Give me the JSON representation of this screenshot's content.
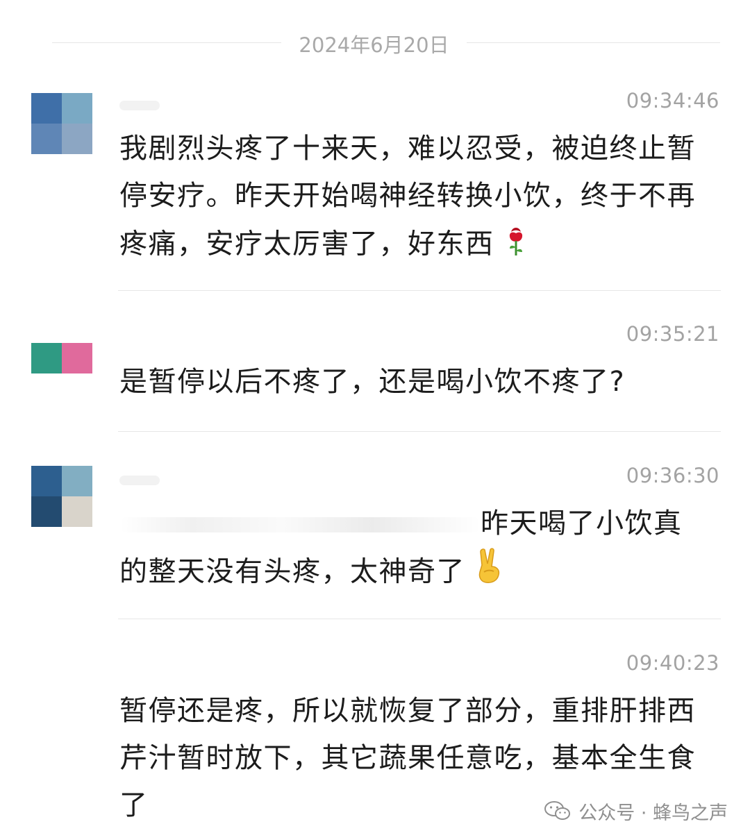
{
  "date_separator": "2024年6月20日",
  "messages": [
    {
      "time": "09:34:46",
      "text": "我剧烈头疼了十来天，难以忍受，被迫终止暂停安疗。昨天开始喝神经转换小饮，终于不再疼痛，安疗太厉害了，好东西",
      "emoji": "rose-emoji",
      "avatar_colors": [
        "#3f6fa8",
        "#7aa9c4",
        "#5f86b6",
        "#8ca6c3"
      ]
    },
    {
      "time": "09:35:21",
      "text": "是暂停以后不疼了，还是喝小饮不疼了?",
      "avatar_colors": [
        "#2f9a83",
        "#e06a9c"
      ]
    },
    {
      "time": "09:36:30",
      "text_visible": "昨天喝了小饮真的整天没有头疼，太神奇了",
      "emoji": "victory-hand-emoji",
      "avatar_colors": [
        "#2d5f8f",
        "#82aec2",
        "#234b70",
        "#d9d4cb"
      ]
    },
    {
      "time": "09:40:23",
      "text": "暂停还是疼，所以就恢复了部分，重排肝排西芹汁暂时放下，其它蔬果任意吃，基本全生食了"
    }
  ],
  "watermark": {
    "label": "公众号 · 蜂鸟之声",
    "icon": "wechat-icon"
  }
}
